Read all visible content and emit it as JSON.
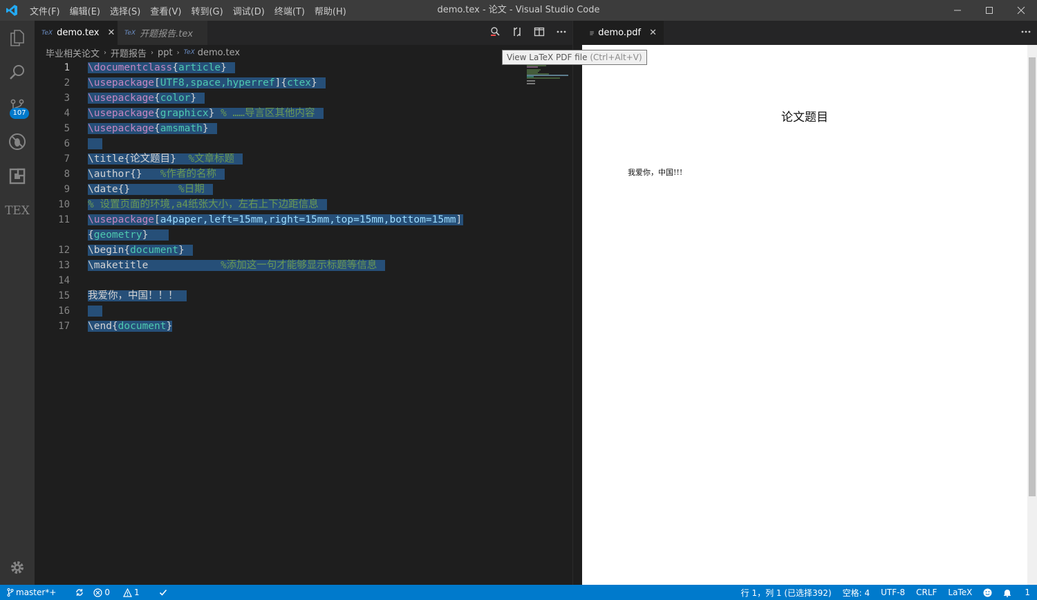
{
  "window": {
    "title": "demo.tex - 论文 - Visual Studio Code",
    "menu": [
      "文件(F)",
      "编辑(E)",
      "选择(S)",
      "查看(V)",
      "转到(G)",
      "调试(D)",
      "终端(T)",
      "帮助(H)"
    ]
  },
  "activity_bar": {
    "scm_badge": "107",
    "tex_label": "TEX"
  },
  "editor": {
    "tabs": [
      {
        "label": "demo.tex",
        "active": true
      },
      {
        "label": "开题报告.tex",
        "active": false
      }
    ],
    "breadcrumb": [
      "毕业相关论文",
      "开题报告",
      "ppt",
      "demo.tex"
    ],
    "tooltip": {
      "text": "View LaTeX PDF file",
      "shortcut": "(Ctrl+Alt+V)"
    }
  },
  "code_lines": [
    {
      "n": "1",
      "text": "\\documentclass{article}"
    },
    {
      "n": "2",
      "text": "\\usepackage[UTF8,space,hyperref]{ctex}"
    },
    {
      "n": "3",
      "text": "\\usepackage{color}"
    },
    {
      "n": "4",
      "text": "\\usepackage{graphicx} % ……导言区其他内容"
    },
    {
      "n": "5",
      "text": "\\usepackage{amsmath}"
    },
    {
      "n": "6",
      "text": ""
    },
    {
      "n": "7",
      "text": "\\title{论文题目}  %文章标题"
    },
    {
      "n": "8",
      "text": "\\author{}   %作者的名称"
    },
    {
      "n": "9",
      "text": "\\date{}        %日期"
    },
    {
      "n": "10",
      "text": "% 设置页面的环境,a4纸张大小，左右上下边距信息"
    },
    {
      "n": "11",
      "text": "\\usepackage[a4paper,left=15mm,right=15mm,top=15mm,bottom=15mm]"
    },
    {
      "n": "",
      "text": "{geometry}"
    },
    {
      "n": "12",
      "text": "\\begin{document}"
    },
    {
      "n": "13",
      "text": "\\maketitle            %添加这一句才能够显示标题等信息"
    },
    {
      "n": "14",
      "text": ""
    },
    {
      "n": "15",
      "text": "我爱你，中国！！！"
    },
    {
      "n": "16",
      "text": ""
    },
    {
      "n": "17",
      "text": "\\end{document}"
    }
  ],
  "pdf": {
    "tab_label": "demo.pdf",
    "title": "论文题目",
    "body": "我爱你，中国!!!"
  },
  "statusbar": {
    "branch": "master*+",
    "errors": "0",
    "warnings": "1",
    "position": "行 1，列 1 (已选择392)",
    "indent": "空格: 4",
    "encoding": "UTF-8",
    "eol": "CRLF",
    "language": "LaTeX",
    "notifications": "1"
  },
  "colors": {
    "accent": "#007acc",
    "selection": "#264f78",
    "keyword": "#c586c0",
    "argument": "#4ec9b0",
    "comment": "#6a9955"
  }
}
